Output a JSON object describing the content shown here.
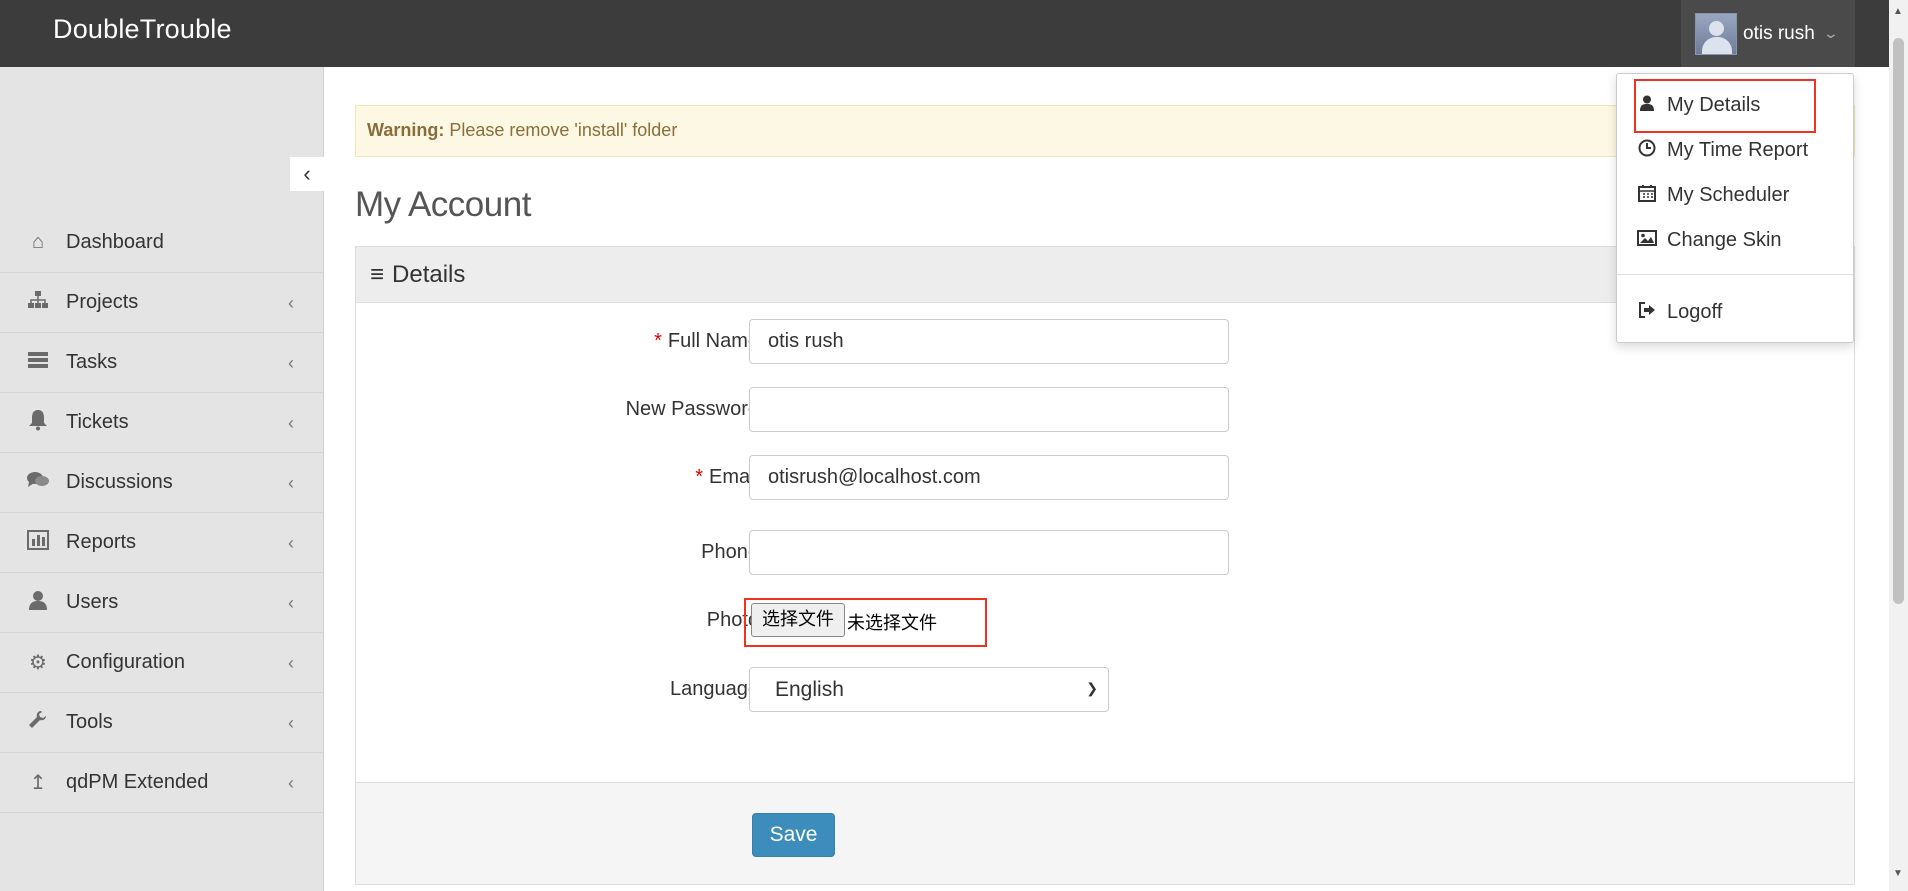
{
  "app": {
    "brand": "DoubleTrouble"
  },
  "user": {
    "name": "otis rush"
  },
  "sidebar": {
    "items": [
      {
        "label": "Dashboard",
        "icon": "home-icon",
        "has_submenu": false
      },
      {
        "label": "Projects",
        "icon": "sitemap-icon",
        "has_submenu": true
      },
      {
        "label": "Tasks",
        "icon": "tasks-icon",
        "has_submenu": true
      },
      {
        "label": "Tickets",
        "icon": "bell-icon",
        "has_submenu": true
      },
      {
        "label": "Discussions",
        "icon": "comments-icon",
        "has_submenu": true
      },
      {
        "label": "Reports",
        "icon": "bar-chart-icon",
        "has_submenu": true
      },
      {
        "label": "Users",
        "icon": "user-icon",
        "has_submenu": true
      },
      {
        "label": "Configuration",
        "icon": "gear-icon",
        "has_submenu": true
      },
      {
        "label": "Tools",
        "icon": "wrench-icon",
        "has_submenu": true
      },
      {
        "label": "qdPM Extended",
        "icon": "upload-icon",
        "has_submenu": true
      }
    ]
  },
  "warning": {
    "strong": "Warning:",
    "text": " Please remove 'install' folder"
  },
  "page": {
    "title": "My Account"
  },
  "panel": {
    "title": "Details"
  },
  "form": {
    "full_name": {
      "label": "Full Name",
      "value": "otis rush",
      "required": true
    },
    "new_password": {
      "label": "New Password",
      "value": "",
      "required": false
    },
    "email": {
      "label": "Email",
      "value": "otisrush@localhost.com",
      "required": true
    },
    "phone": {
      "label": "Phone",
      "value": "",
      "required": false
    },
    "photo": {
      "label": "Photo",
      "button": "选择文件",
      "status": "未选择文件"
    },
    "language": {
      "label": "Language",
      "value": "English"
    },
    "save_label": "Save"
  },
  "user_menu": {
    "items": [
      {
        "label": "My Details",
        "icon": "user-icon"
      },
      {
        "label": "My Time Report",
        "icon": "clock-icon"
      },
      {
        "label": "My Scheduler",
        "icon": "calendar-icon"
      },
      {
        "label": "Change Skin",
        "icon": "image-icon"
      },
      {
        "label": "Logoff",
        "icon": "sign-out-icon"
      }
    ]
  },
  "colors": {
    "topbar": "#3c3c3c",
    "sidebar": "#e4e4e4",
    "primary_button": "#3c8dbc",
    "warning_bg": "#fcf8e3",
    "highlight": "#ee3322"
  }
}
